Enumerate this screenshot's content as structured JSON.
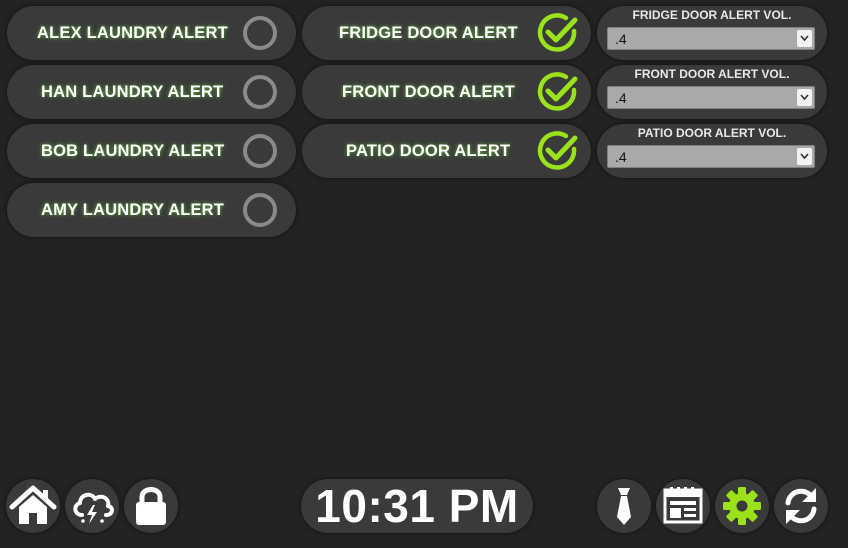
{
  "laundry_alerts": [
    {
      "label": "ALEX LAUNDRY ALERT",
      "state": "off"
    },
    {
      "label": "HAN LAUNDRY ALERT",
      "state": "off"
    },
    {
      "label": "BOB LAUNDRY ALERT",
      "state": "off"
    },
    {
      "label": "AMY LAUNDRY ALERT",
      "state": "off"
    }
  ],
  "door_alerts": [
    {
      "label": "FRIDGE DOOR ALERT",
      "state": "on"
    },
    {
      "label": "FRONT DOOR ALERT",
      "state": "on"
    },
    {
      "label": "PATIO DOOR ALERT",
      "state": "on"
    }
  ],
  "volume_controls": [
    {
      "title": "FRIDGE DOOR ALERT VOL.",
      "value": ".4"
    },
    {
      "title": "FRONT DOOR ALERT VOL.",
      "value": ".4"
    },
    {
      "title": "PATIO DOOR ALERT VOL.",
      "value": ".4"
    }
  ],
  "clock": {
    "time": "10:31 PM"
  },
  "nav_left": [
    "home-icon",
    "storm-cloud-icon",
    "lock-icon"
  ],
  "nav_right": [
    "tie-icon",
    "calendar-icon",
    "gear-icon",
    "refresh-icon"
  ],
  "colors": {
    "background": "#232323",
    "pill": "#3a3a3a",
    "accent_green": "#9be21b",
    "ring_off": "#8a8a8a",
    "icon_white": "#ffffff"
  }
}
